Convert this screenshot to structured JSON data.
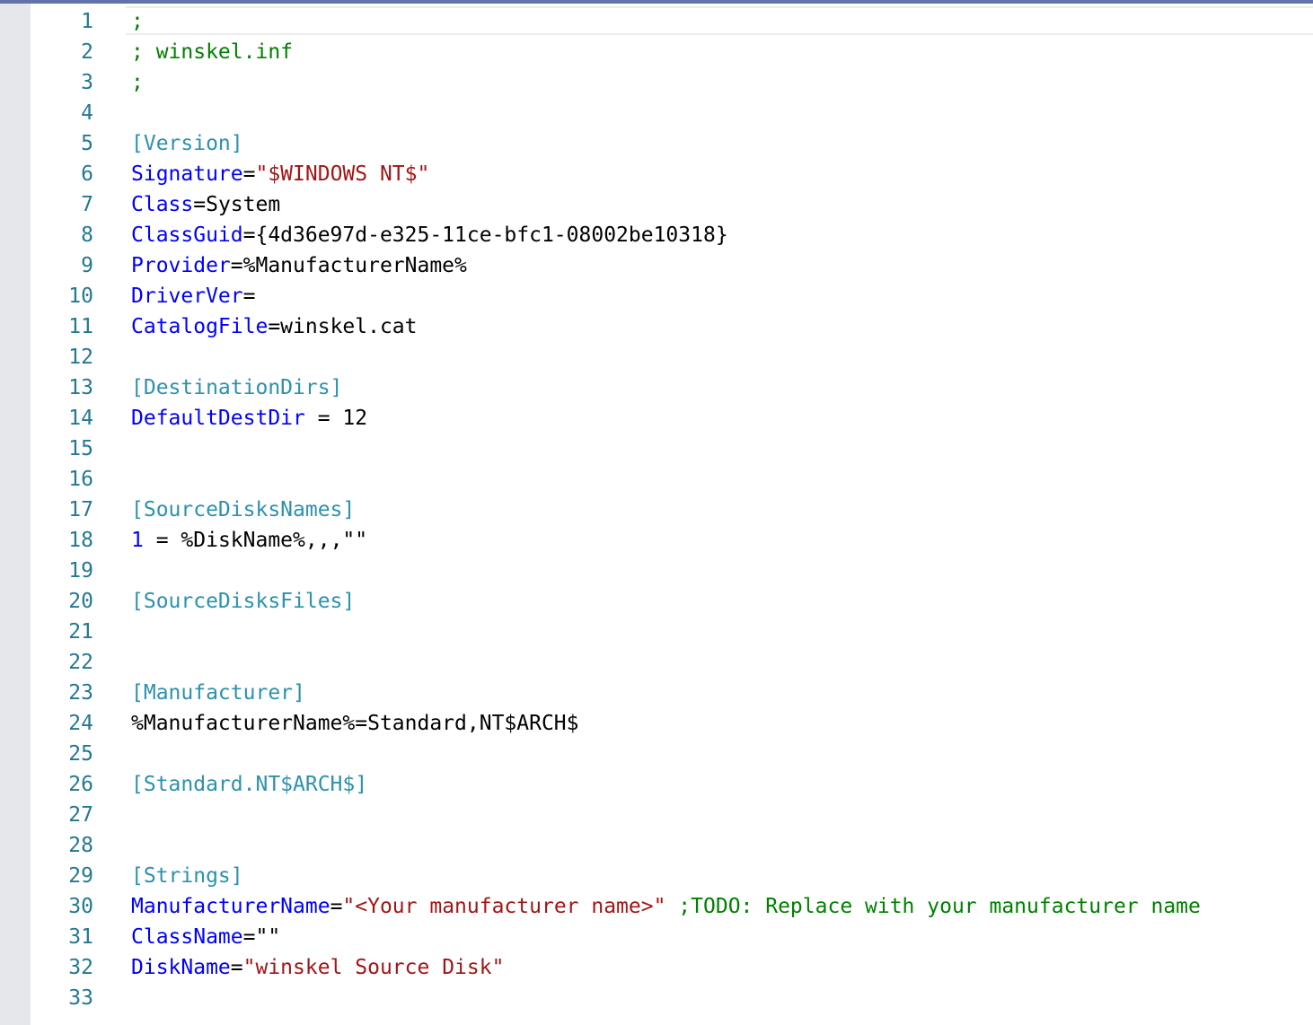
{
  "editor": {
    "file_name": "winskel.inf",
    "lines": [
      {
        "n": "1",
        "tokens": [
          {
            "t": ";",
            "c": "comment"
          }
        ]
      },
      {
        "n": "2",
        "tokens": [
          {
            "t": "; winskel.inf",
            "c": "comment"
          }
        ]
      },
      {
        "n": "3",
        "tokens": [
          {
            "t": ";",
            "c": "comment"
          }
        ]
      },
      {
        "n": "4",
        "tokens": []
      },
      {
        "n": "5",
        "tokens": [
          {
            "t": "[Version]",
            "c": "section"
          }
        ]
      },
      {
        "n": "6",
        "tokens": [
          {
            "t": "Signature",
            "c": "key"
          },
          {
            "t": "=",
            "c": "plain"
          },
          {
            "t": "\"$WINDOWS NT$\"",
            "c": "str"
          }
        ]
      },
      {
        "n": "7",
        "tokens": [
          {
            "t": "Class",
            "c": "key"
          },
          {
            "t": "=System",
            "c": "plain"
          }
        ]
      },
      {
        "n": "8",
        "tokens": [
          {
            "t": "ClassGuid",
            "c": "key"
          },
          {
            "t": "={4d36e97d-e325-11ce-bfc1-08002be10318}",
            "c": "plain"
          }
        ]
      },
      {
        "n": "9",
        "tokens": [
          {
            "t": "Provider",
            "c": "key"
          },
          {
            "t": "=%ManufacturerName%",
            "c": "plain"
          }
        ]
      },
      {
        "n": "10",
        "tokens": [
          {
            "t": "DriverVer",
            "c": "key"
          },
          {
            "t": "=",
            "c": "plain"
          }
        ]
      },
      {
        "n": "11",
        "tokens": [
          {
            "t": "CatalogFile",
            "c": "key"
          },
          {
            "t": "=winskel.cat",
            "c": "plain"
          }
        ]
      },
      {
        "n": "12",
        "tokens": []
      },
      {
        "n": "13",
        "tokens": [
          {
            "t": "[DestinationDirs]",
            "c": "section"
          }
        ]
      },
      {
        "n": "14",
        "tokens": [
          {
            "t": "DefaultDestDir",
            "c": "key"
          },
          {
            "t": " = 12",
            "c": "plain"
          }
        ]
      },
      {
        "n": "15",
        "tokens": []
      },
      {
        "n": "16",
        "tokens": []
      },
      {
        "n": "17",
        "tokens": [
          {
            "t": "[SourceDisksNames]",
            "c": "section"
          }
        ]
      },
      {
        "n": "18",
        "tokens": [
          {
            "t": "1",
            "c": "key"
          },
          {
            "t": " = %DiskName%,,,\"\"",
            "c": "plain"
          }
        ]
      },
      {
        "n": "19",
        "tokens": []
      },
      {
        "n": "20",
        "tokens": [
          {
            "t": "[SourceDisksFiles]",
            "c": "section"
          }
        ]
      },
      {
        "n": "21",
        "tokens": []
      },
      {
        "n": "22",
        "tokens": []
      },
      {
        "n": "23",
        "tokens": [
          {
            "t": "[Manufacturer]",
            "c": "section"
          }
        ]
      },
      {
        "n": "24",
        "tokens": [
          {
            "t": "%ManufacturerName%=Standard,NT$ARCH$",
            "c": "plain"
          }
        ]
      },
      {
        "n": "25",
        "tokens": []
      },
      {
        "n": "26",
        "tokens": [
          {
            "t": "[Standard.NT$ARCH$]",
            "c": "section"
          }
        ]
      },
      {
        "n": "27",
        "tokens": []
      },
      {
        "n": "28",
        "tokens": []
      },
      {
        "n": "29",
        "tokens": [
          {
            "t": "[Strings]",
            "c": "section"
          }
        ]
      },
      {
        "n": "30",
        "tokens": [
          {
            "t": "ManufacturerName",
            "c": "key"
          },
          {
            "t": "=",
            "c": "plain"
          },
          {
            "t": "\"<Your manufacturer name>\"",
            "c": "str"
          },
          {
            "t": " ;TODO: Replace with your manufacturer name",
            "c": "comment"
          }
        ]
      },
      {
        "n": "31",
        "tokens": [
          {
            "t": "ClassName",
            "c": "key"
          },
          {
            "t": "=\"\"",
            "c": "plain"
          }
        ]
      },
      {
        "n": "32",
        "tokens": [
          {
            "t": "DiskName",
            "c": "key"
          },
          {
            "t": "=",
            "c": "plain"
          },
          {
            "t": "\"winskel Source Disk\"",
            "c": "str"
          }
        ]
      },
      {
        "n": "33",
        "tokens": []
      }
    ]
  },
  "colors": {
    "comment": "#008000",
    "section": "#2b91af",
    "key": "#0000ff",
    "string": "#a31515",
    "plain": "#000000",
    "line_number": "#237893"
  }
}
